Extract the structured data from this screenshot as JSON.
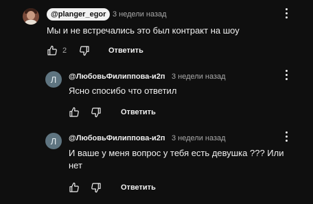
{
  "comment": {
    "author": "@planger_egor",
    "time": "3 недели назад",
    "text": "Мы и не встречались это был контракт на шоу",
    "likes": "2",
    "reply_label": "Ответить"
  },
  "replies": [
    {
      "avatar_letter": "Л",
      "author": "@ЛюбовьФилиппова-и2п",
      "time": "3 недели назад",
      "text": "Ясно спосибо что ответил",
      "reply_label": "Ответить"
    },
    {
      "avatar_letter": "Л",
      "author": "@ЛюбовьФилиппова-и2п",
      "time": "3 недели назад",
      "text_line1": "И ваше у меня вопрос у тебя есть девушка ??? Или",
      "text_line2": "нет",
      "reply_label": "Ответить"
    }
  ],
  "icons": {
    "like": "thumbs-up-icon",
    "dislike": "thumbs-down-icon",
    "menu": "more-vert-icon"
  }
}
